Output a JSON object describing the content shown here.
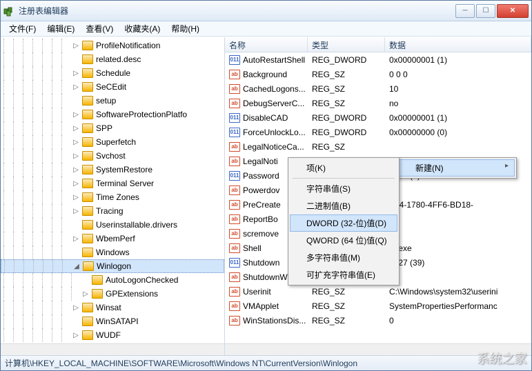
{
  "window": {
    "title": "注册表编辑器"
  },
  "menubar": [
    "文件(F)",
    "编辑(E)",
    "查看(V)",
    "收藏夹(A)",
    "帮助(H)"
  ],
  "columns": {
    "name": "名称",
    "type": "类型",
    "data": "数据"
  },
  "tree": [
    {
      "indent": 7,
      "exp": "▷",
      "label": "ProfileNotification"
    },
    {
      "indent": 7,
      "exp": "",
      "label": "related.desc"
    },
    {
      "indent": 7,
      "exp": "▷",
      "label": "Schedule"
    },
    {
      "indent": 7,
      "exp": "▷",
      "label": "SeCEdit"
    },
    {
      "indent": 7,
      "exp": "",
      "label": "setup"
    },
    {
      "indent": 7,
      "exp": "▷",
      "label": "SoftwareProtectionPlatfo"
    },
    {
      "indent": 7,
      "exp": "▷",
      "label": "SPP"
    },
    {
      "indent": 7,
      "exp": "▷",
      "label": "Superfetch"
    },
    {
      "indent": 7,
      "exp": "▷",
      "label": "Svchost"
    },
    {
      "indent": 7,
      "exp": "▷",
      "label": "SystemRestore"
    },
    {
      "indent": 7,
      "exp": "▷",
      "label": "Terminal Server"
    },
    {
      "indent": 7,
      "exp": "▷",
      "label": "Time Zones"
    },
    {
      "indent": 7,
      "exp": "▷",
      "label": "Tracing"
    },
    {
      "indent": 7,
      "exp": "",
      "label": "Userinstallable.drivers"
    },
    {
      "indent": 7,
      "exp": "▷",
      "label": "WbemPerf"
    },
    {
      "indent": 7,
      "exp": "",
      "label": "Windows"
    },
    {
      "indent": 7,
      "exp": "◢",
      "label": "Winlogon",
      "selected": true
    },
    {
      "indent": 8,
      "exp": "",
      "label": "AutoLogonChecked"
    },
    {
      "indent": 8,
      "exp": "▷",
      "label": "GPExtensions"
    },
    {
      "indent": 7,
      "exp": "▷",
      "label": "Winsat"
    },
    {
      "indent": 7,
      "exp": "",
      "label": "WinSATAPI"
    },
    {
      "indent": 7,
      "exp": "▷",
      "label": "WUDF"
    }
  ],
  "rows": [
    {
      "icon": "dw",
      "name": "AutoRestartShell",
      "type": "REG_DWORD",
      "data": "0x00000001 (1)"
    },
    {
      "icon": "sz",
      "name": "Background",
      "type": "REG_SZ",
      "data": "0 0 0"
    },
    {
      "icon": "sz",
      "name": "CachedLogons...",
      "type": "REG_SZ",
      "data": "10"
    },
    {
      "icon": "sz",
      "name": "DebugServerC...",
      "type": "REG_SZ",
      "data": "no"
    },
    {
      "icon": "dw",
      "name": "DisableCAD",
      "type": "REG_DWORD",
      "data": "0x00000001 (1)"
    },
    {
      "icon": "dw",
      "name": "ForceUnlockLo...",
      "type": "REG_DWORD",
      "data": "0x00000000 (0)"
    },
    {
      "icon": "sz",
      "name": "LegalNoticeCa...",
      "type": "REG_SZ",
      "data": ""
    },
    {
      "icon": "sz",
      "name": "LegalNoti",
      "type": "",
      "data": ""
    },
    {
      "icon": "dw",
      "name": "Password",
      "type": "",
      "data": "0005 (5)"
    },
    {
      "icon": "sz",
      "name": "Powerdov",
      "type": "",
      "data": ""
    },
    {
      "icon": "sz",
      "name": "PreCreate",
      "type": "",
      "data": "1A4-1780-4FF6-BD18-"
    },
    {
      "icon": "sz",
      "name": "ReportBo",
      "type": "",
      "data": ""
    },
    {
      "icon": "sz",
      "name": "scremove",
      "type": "",
      "data": ""
    },
    {
      "icon": "sz",
      "name": "Shell",
      "type": "",
      "data": "er.exe"
    },
    {
      "icon": "dw",
      "name": "Shutdown",
      "type": "",
      "data": "0027 (39)"
    },
    {
      "icon": "sz",
      "name": "ShutdownWith...",
      "type": "REG_SZ",
      "data": "0"
    },
    {
      "icon": "sz",
      "name": "Userinit",
      "type": "REG_SZ",
      "data": "C:\\Windows\\system32\\userini"
    },
    {
      "icon": "sz",
      "name": "VMApplet",
      "type": "REG_SZ",
      "data": "SystemPropertiesPerformanc"
    },
    {
      "icon": "sz",
      "name": "WinStationsDis...",
      "type": "REG_SZ",
      "data": "0"
    }
  ],
  "contextMenu1": {
    "items": [
      {
        "label": "新建(N)",
        "sub": true,
        "hl": true
      }
    ]
  },
  "contextMenu2": {
    "items": [
      {
        "label": "项(K)"
      },
      {
        "sep": true
      },
      {
        "label": "字符串值(S)"
      },
      {
        "label": "二进制值(B)"
      },
      {
        "label": "DWORD (32-位)值(D)",
        "hl": true
      },
      {
        "label": "QWORD (64 位)值(Q)"
      },
      {
        "label": "多字符串值(M)"
      },
      {
        "label": "可扩充字符串值(E)"
      }
    ]
  },
  "statusbar": "计算机\\HKEY_LOCAL_MACHINE\\SOFTWARE\\Microsoft\\Windows NT\\CurrentVersion\\Winlogon",
  "watermark": "系统之家"
}
